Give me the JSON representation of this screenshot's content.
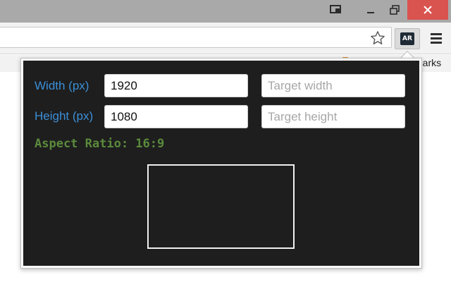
{
  "window": {
    "controls": {
      "cast_icon": "cast-icon",
      "minimize": "–",
      "maximize": "❐",
      "close": "✕"
    }
  },
  "toolbar": {
    "extension_badge": "AR",
    "star_icon": "star-icon",
    "menu_icon": "hamburger-menu-icon"
  },
  "bookmarks": {
    "partial_label": "marks"
  },
  "popup": {
    "width_label": "Width (px)",
    "height_label": "Height (px)",
    "width_value": "1920",
    "height_value": "1080",
    "target_width_placeholder": "Target width",
    "target_height_placeholder": "Target height",
    "aspect_ratio_text": "Aspect Ratio: 16:9"
  },
  "colors": {
    "panel_bg": "#1e1e1e",
    "label_blue": "#3b8fd8",
    "ratio_green": "#5a8a3c",
    "close_red": "#d9534f"
  }
}
